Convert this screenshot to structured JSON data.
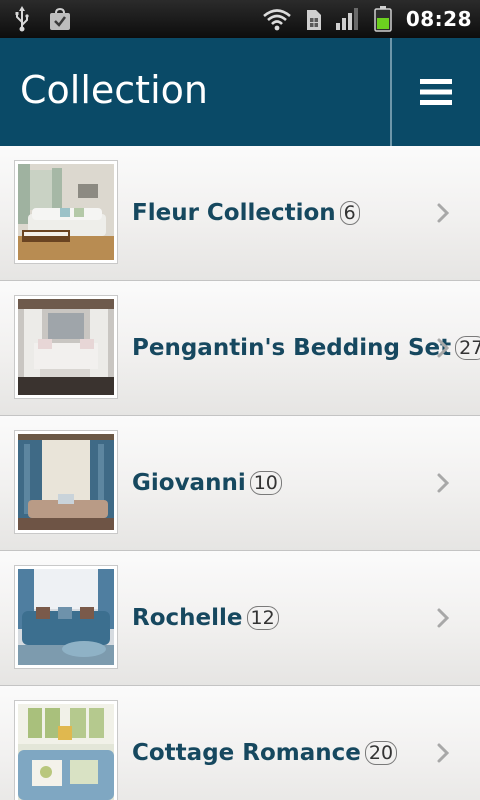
{
  "status_bar": {
    "time": "08:28",
    "icons": [
      "usb-icon",
      "shopping-bag-icon",
      "wifi-icon",
      "sim-card-icon",
      "signal-icon",
      "battery-icon"
    ]
  },
  "header": {
    "title": "Collection",
    "menu_icon": "hamburger-menu-icon"
  },
  "collection": {
    "items": [
      {
        "title": "Fleur Collection",
        "count": "6"
      },
      {
        "title": "Pengantin's Bedding Set",
        "count": "27"
      },
      {
        "title": "Giovanni",
        "count": "10"
      },
      {
        "title": "Rochelle",
        "count": "12"
      },
      {
        "title": "Cottage Romance",
        "count": "20"
      }
    ]
  },
  "colors": {
    "header_bg": "#0a4a67",
    "title_text": "#16485f",
    "battery_fill": "#6ccf1f"
  }
}
